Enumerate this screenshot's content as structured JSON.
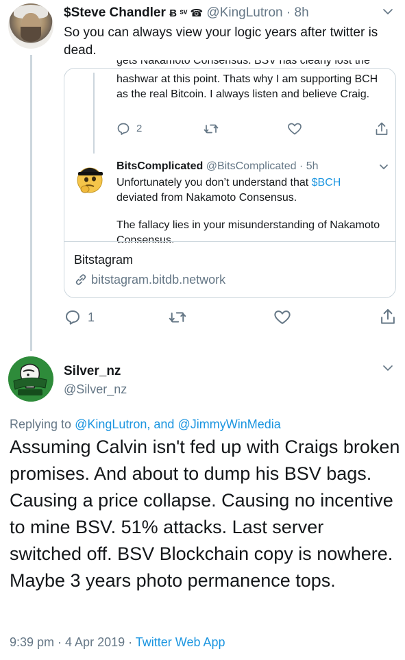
{
  "tweet1": {
    "display_name": "$Steve Chandler",
    "flair": "Ƀ ˢᵛ ☎",
    "handle": "@KingLutron",
    "time": "8h",
    "text": "So you can always view your logic years after twitter is dead.",
    "quote": {
      "cut_text": "gets Nakamoto Consensus. BSV has clearly lost the",
      "text": "hashwar at this point. Thats why I am supporting BCH as the real Bitcoin. I always listen and believe Craig.",
      "reply_count": "2",
      "reply": {
        "display_name": "BitsComplicated",
        "handle": "@BitsComplicated",
        "time": "5h",
        "text_before": "Unfortunately you don’t understand that ",
        "cashtag": "$BCH",
        "text_after": " deviated from Nakamoto Consensus.",
        "text2": "The fallacy lies in your misunderstanding of Nakamoto Consensus."
      },
      "card_title": "Bitstagram",
      "card_url": "bitstagram.bitdb.network"
    },
    "reply_count": "1"
  },
  "tweet2": {
    "display_name": "Silver_nz",
    "handle": "@Silver_nz",
    "replying_prefix": "Replying to ",
    "replying_user1": "@KingLutron",
    "replying_mid": ", and ",
    "replying_user2": "@JimmyWinMedia",
    "text": "Assuming Calvin isn't fed up with Craigs broken promises. And about to dump his BSV bags. Causing a price collapse. Causing no incentive to mine BSV. 51% attacks. Last server switched off. BSV Blockchain copy is nowhere. Maybe 3 years photo permanence tops.",
    "timestamp": "9:39 pm · 4 Apr 2019 · ",
    "source": "Twitter Web App"
  },
  "colors": {
    "link": "#1b95e0",
    "secondary": "#657786",
    "border": "#ccd6dd"
  }
}
